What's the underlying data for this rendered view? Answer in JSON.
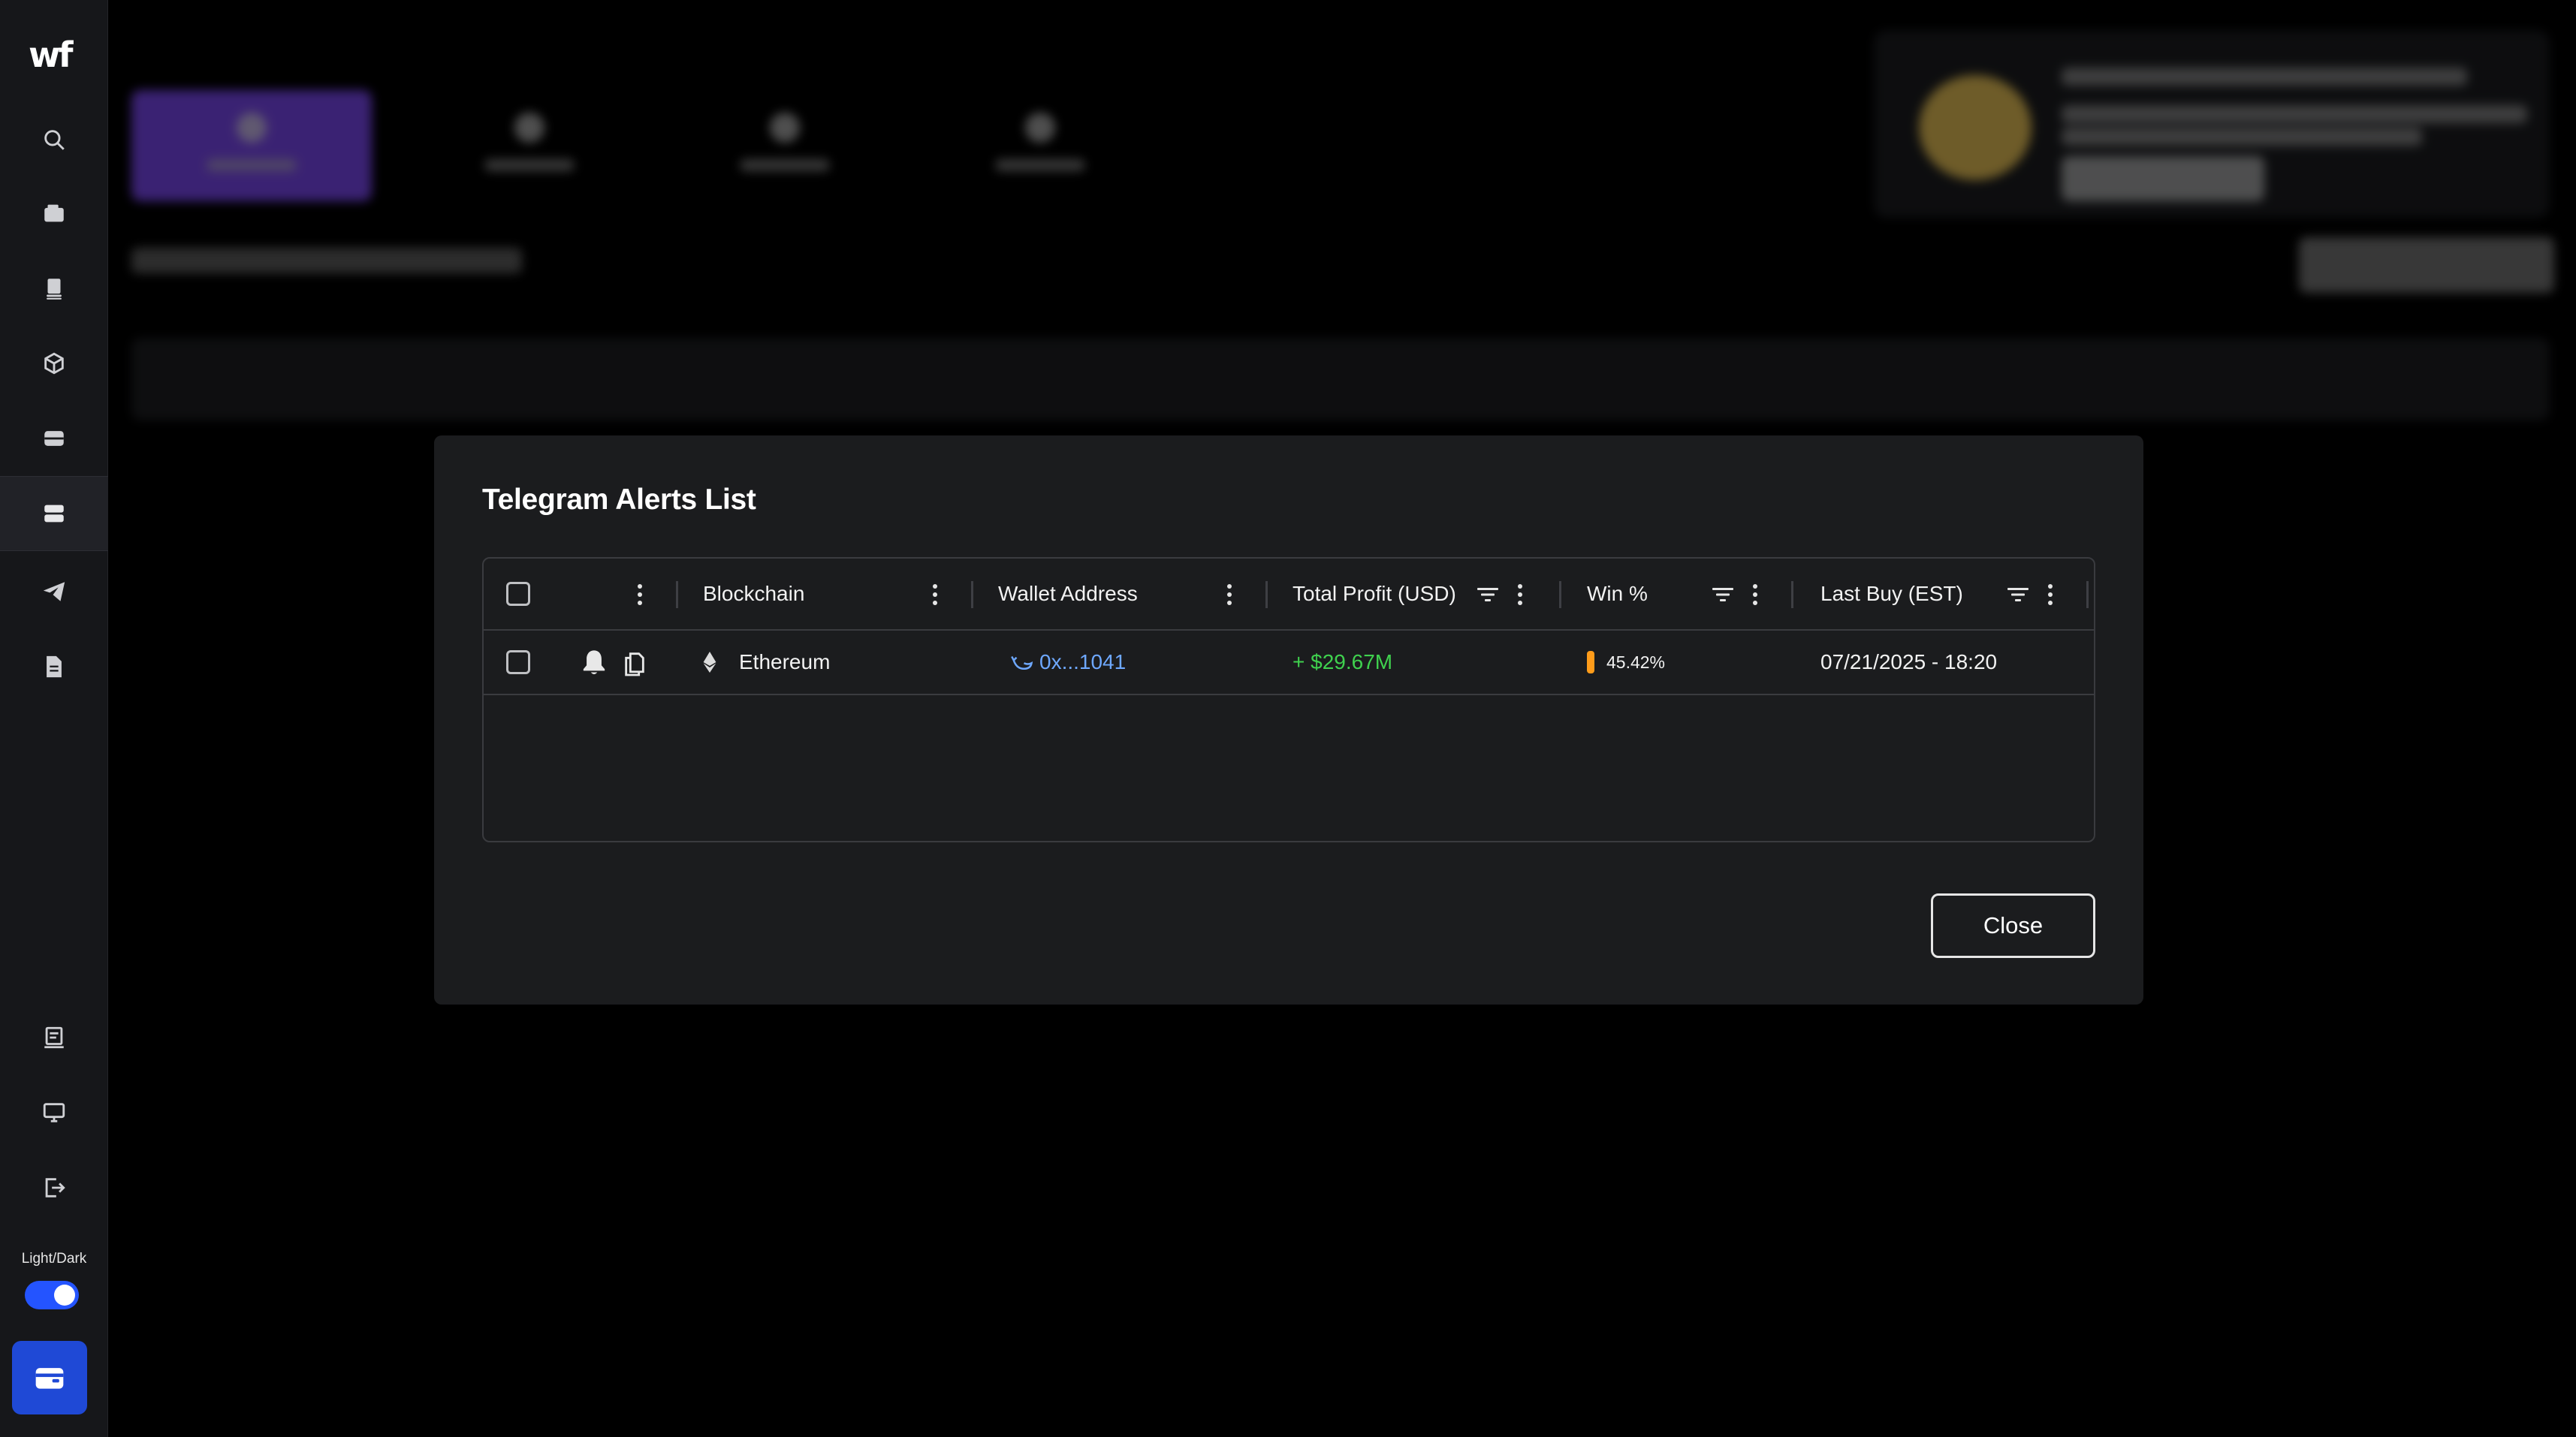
{
  "app": {
    "logo": "wf"
  },
  "sidebar": {
    "items": [
      {
        "icon": "search-icon"
      },
      {
        "icon": "wallet-icon"
      },
      {
        "icon": "document-stack-icon"
      },
      {
        "icon": "box-icon"
      },
      {
        "icon": "inbox-icon"
      },
      {
        "icon": "server-icon",
        "active": true
      },
      {
        "icon": "send-icon"
      },
      {
        "icon": "file-icon"
      }
    ],
    "bottom_items": [
      {
        "icon": "receipt-icon"
      },
      {
        "icon": "monitor-icon"
      },
      {
        "icon": "logout-icon"
      }
    ],
    "theme_toggle_label": "Light/Dark",
    "theme_toggle_on": true
  },
  "modal": {
    "title": "Telegram Alerts List",
    "columns": [
      {
        "label": "Blockchain"
      },
      {
        "label": "Wallet Address"
      },
      {
        "label": "Total Profit (USD)",
        "filter": true
      },
      {
        "label": "Win %",
        "filter": true
      },
      {
        "label": "Last Buy (EST)",
        "filter": true
      }
    ],
    "rows": [
      {
        "blockchain": "Ethereum",
        "wallet": "0x...1041",
        "profit": "+ $29.67M",
        "win": "45.42%",
        "last_buy": "07/21/2025 - 18:20"
      }
    ],
    "close_label": "Close"
  },
  "colors": {
    "profit_positive": "#3fd14e",
    "wallet_link": "#6ea8ff",
    "win_indicator": "#ff9c1a",
    "accent": "#2454ff"
  }
}
